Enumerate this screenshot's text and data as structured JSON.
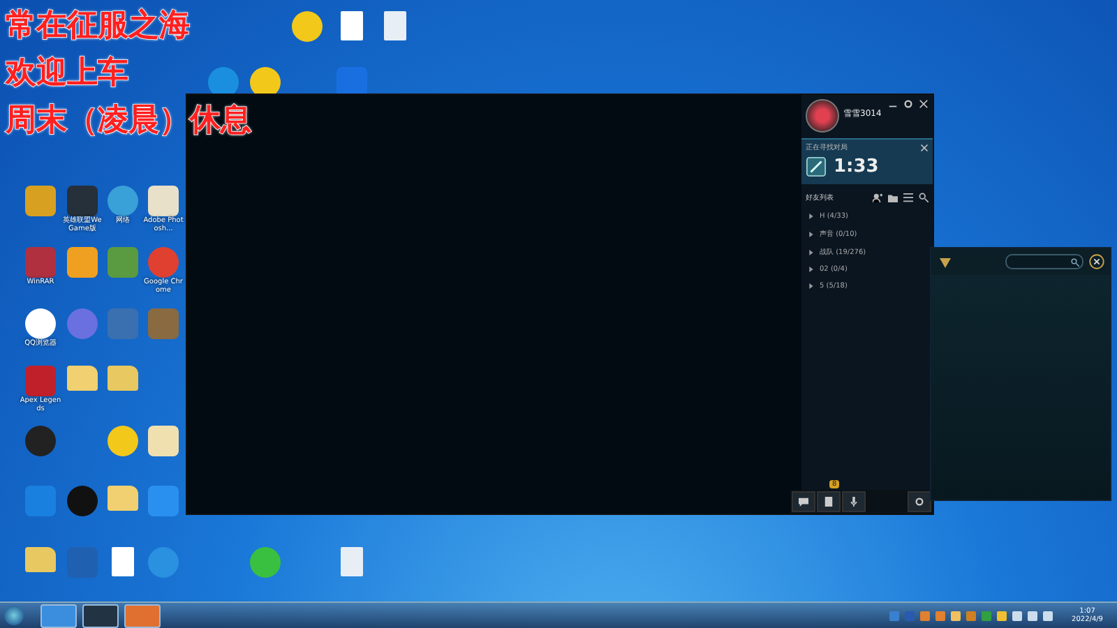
{
  "overlay_lines": [
    "常在征服之海",
    "欢迎上车",
    "周末（凌晨）休息"
  ],
  "desktop_icons": [
    {
      "kind": "round",
      "color": "#f2c81a"
    },
    {
      "kind": "document",
      "color": "#ffffff"
    },
    {
      "kind": "document",
      "color": "#e8eef5"
    },
    {
      "kind": "round",
      "color": "#1a8fe0"
    },
    {
      "kind": "round",
      "color": "#f2c81a"
    },
    {
      "kind": "tile",
      "color": "#1a6fe0"
    },
    {
      "kind": "tile",
      "color": "#d8a020"
    },
    {
      "kind": "tile",
      "color": "#25303a",
      "label": "英雄联盟WeGame版"
    },
    {
      "kind": "round",
      "color": "#3aa0d8",
      "label": "网络"
    },
    {
      "kind": "tile",
      "color": "#e8e0c8",
      "label": "Adobe Photosh..."
    },
    {
      "kind": "tile",
      "color": "#b03040",
      "label": "WinRAR"
    },
    {
      "kind": "tile",
      "color": "#f0a020"
    },
    {
      "kind": "tile",
      "color": "#5a9a40"
    },
    {
      "kind": "round",
      "color": "#e04030",
      "label": "Google Chrome"
    },
    {
      "kind": "round",
      "color": "#ffffff",
      "label": "QQ浏览器"
    },
    {
      "kind": "round",
      "color": "#6a70e0"
    },
    {
      "kind": "tile",
      "color": "#3a70b0"
    },
    {
      "kind": "tile",
      "color": "#8a6a40"
    },
    {
      "kind": "tile",
      "color": "#c0202a",
      "label": "Apex Legends"
    },
    {
      "kind": "folder",
      "color": "#f0d070"
    },
    {
      "kind": "folder",
      "color": "#e8c860"
    },
    {
      "kind": "round",
      "color": "#222222"
    },
    {
      "kind": "round",
      "color": "#f2c81a"
    },
    {
      "kind": "tile",
      "color": "#f0e0b0"
    },
    {
      "kind": "tile",
      "color": "#1a80e0"
    },
    {
      "kind": "round",
      "color": "#111111"
    },
    {
      "kind": "folder",
      "color": "#f0d070"
    },
    {
      "kind": "tile",
      "color": "#2a90f0"
    },
    {
      "kind": "folder",
      "color": "#e8c860"
    },
    {
      "kind": "tile",
      "color": "#2060b0"
    },
    {
      "kind": "document",
      "color": "#ffffff"
    },
    {
      "kind": "round",
      "color": "#2a90e0"
    },
    {
      "kind": "round",
      "color": "#3ac040"
    },
    {
      "kind": "document",
      "color": "#e8eef5"
    }
  ],
  "client": {
    "profile": {
      "name": "雪雪3014"
    },
    "queue": {
      "title": "正在寻找对局",
      "time": "1:33"
    },
    "friends": {
      "title": "好友列表",
      "groups": [
        {
          "name": "H (4/33)",
          "expanded": false
        },
        {
          "name": "声音 (0/10)",
          "expanded": false
        },
        {
          "name": "战队 (19/276)",
          "expanded": false
        },
        {
          "name": "02 (0/4)",
          "expanded": false
        },
        {
          "name": "5 (5/18)",
          "expanded": false
        }
      ]
    },
    "bottom_bar": {
      "badge": "8"
    }
  },
  "taskbar": {
    "time": "1:07",
    "date": "2022/4/9"
  }
}
